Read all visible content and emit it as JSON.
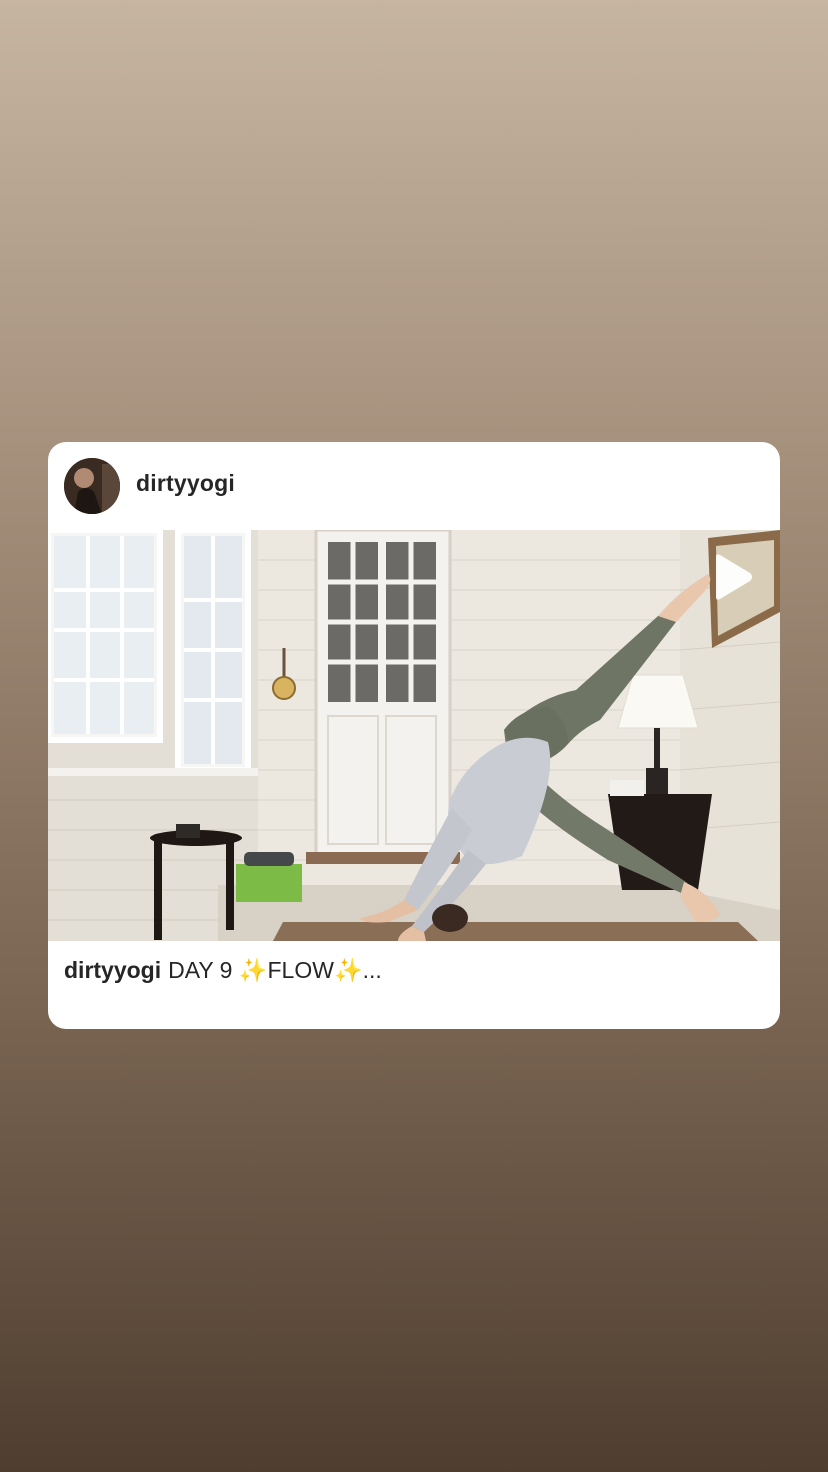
{
  "story_card": {
    "username": "dirtyyogi",
    "avatar_icon": "profile-photo",
    "media": {
      "type": "video",
      "overlay_icon": "play-icon",
      "scene": "yoga pose in a sunroom"
    },
    "caption": {
      "username": "dirtyyogi",
      "text": "DAY 9 ✨FLOW✨..."
    }
  },
  "colors": {
    "background_top": "#c6b5a1",
    "background_bottom": "#4f3e30",
    "card": "#ffffff",
    "text": "#262626"
  }
}
